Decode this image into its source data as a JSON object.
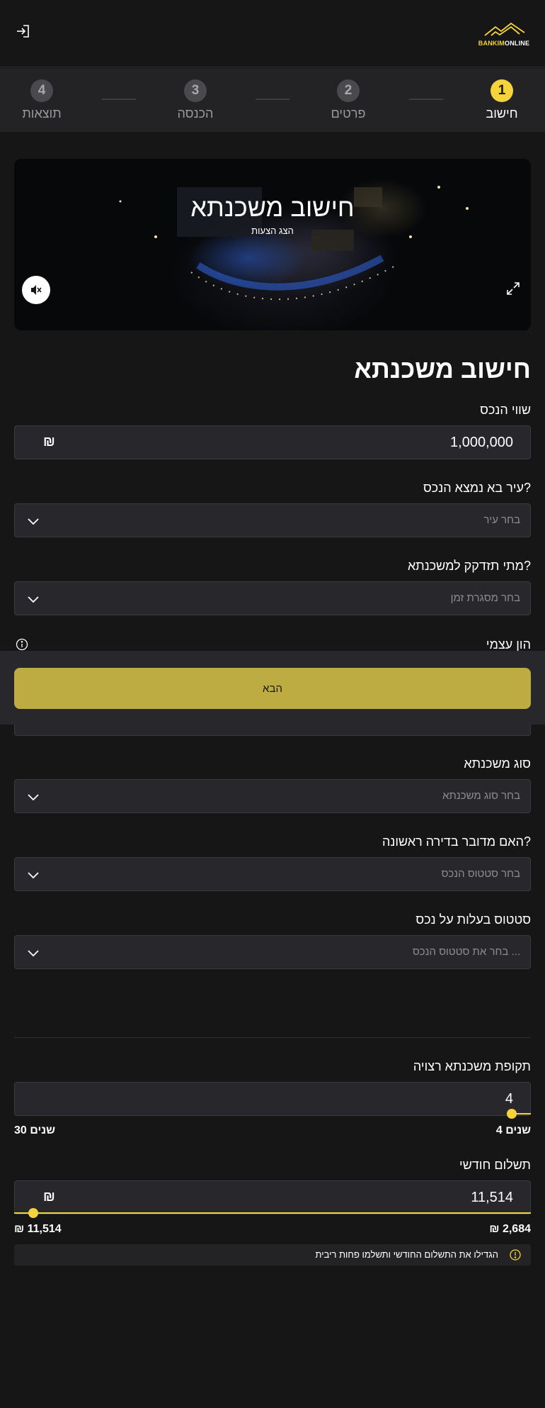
{
  "logo": {
    "part1": "BANKIM",
    "part2": "ONLINE"
  },
  "stepper": [
    {
      "number": "1",
      "label": "חישוב"
    },
    {
      "number": "2",
      "label": "פרטים"
    },
    {
      "number": "3",
      "label": "הכנסה"
    },
    {
      "number": "4",
      "label": "תוצאות"
    }
  ],
  "video": {
    "title": "חישוב משכנתא",
    "subtitle": "הצג הצעות"
  },
  "form": {
    "title": "חישוב משכנתא",
    "property_value": {
      "label": "שווי הנכס",
      "value": "1,000,000",
      "currency": "₪"
    },
    "city": {
      "label": "עיר בא נמצא הנכס?",
      "placeholder": "בחר עיר"
    },
    "timeframe": {
      "label": "מתי תזדקק למשכנתא?",
      "placeholder": "בחר מסגרת זמן"
    },
    "equity": {
      "label": "הון עצמי"
    },
    "mortgage_type": {
      "label": "סוג משכנתא",
      "placeholder": "בחר סוג משכנתא"
    },
    "first_apartment": {
      "label": "האם מדובר בדירה ראשונה?",
      "placeholder": "בחר סטטוס הנכס"
    },
    "ownership": {
      "label": "סטטוס בעלות על נכס",
      "placeholder": "בחר את סטטוס הנכס ..."
    }
  },
  "sticky": {
    "next_label": "הבא"
  },
  "period": {
    "label": "תקופת משכנתא רצויה",
    "value": "4",
    "min_label": "4 שנים",
    "max_label": "30 שנים",
    "level": 0.0
  },
  "payment": {
    "label": "תשלום חודשי",
    "value": "11,514",
    "currency": "₪",
    "min_label": "₪ 2,684",
    "max_label": "₪ 11,514",
    "level": 1.0
  },
  "tip": {
    "text": "הגדילו את התשלום החודשי ותשלמו פחות ריבית"
  },
  "colors": {
    "accent": "#f5d33b",
    "button": "#bcac42",
    "background": "#161616",
    "field": "#28282c"
  }
}
